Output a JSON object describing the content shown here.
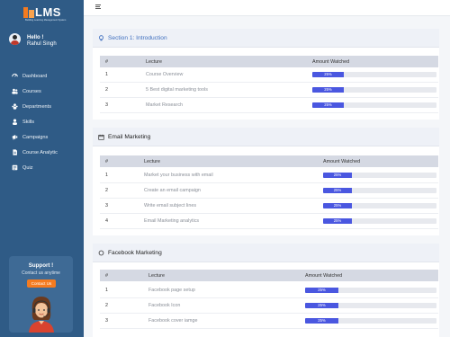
{
  "brand": {
    "name": "LMS",
    "tagline": "Building Learning Management System",
    "accent": "#f47b20",
    "sidebar_bg": "#2f5b86"
  },
  "profile": {
    "greeting": "Hello !",
    "name": "Rahul Singh"
  },
  "nav": [
    {
      "label": "Dashboard",
      "icon": "dashboard-icon"
    },
    {
      "label": "Courses",
      "icon": "users-icon"
    },
    {
      "label": "Departments",
      "icon": "department-icon"
    },
    {
      "label": "Skills",
      "icon": "user-icon"
    },
    {
      "label": "Campaigns",
      "icon": "megaphone-icon"
    },
    {
      "label": "Course Analytic",
      "icon": "document-icon"
    },
    {
      "label": "Quiz",
      "icon": "quiz-icon"
    }
  ],
  "support": {
    "title": "Support !",
    "subtitle": "Contact us anytime",
    "button": "Contact Us"
  },
  "sections": [
    {
      "title": "Section 1: Introduction",
      "icon": "bulb-icon",
      "headers": {
        "num": "#",
        "lecture": "Lecture",
        "watched": "Amount Watched"
      },
      "rows": [
        {
          "num": "1",
          "lecture": "Course Overview",
          "pct": "25%",
          "value": 0.25
        },
        {
          "num": "2",
          "lecture": "5 Best digital marketing tools",
          "pct": "25%",
          "value": 0.25
        },
        {
          "num": "3",
          "lecture": "Market Research",
          "pct": "25%",
          "value": 0.25
        }
      ]
    },
    {
      "title": "Email Marketing",
      "icon": "calendar-icon",
      "headers": {
        "num": "#",
        "lecture": "Lecture",
        "watched": "Amount Watched"
      },
      "rows": [
        {
          "num": "1",
          "lecture": "Market your business with email",
          "pct": "25%",
          "value": 0.25
        },
        {
          "num": "2",
          "lecture": "Create an email campaign",
          "pct": "25%",
          "value": 0.25
        },
        {
          "num": "3",
          "lecture": "Write email subject lines",
          "pct": "25%",
          "value": 0.25
        },
        {
          "num": "4",
          "lecture": "Email Marketing analytics",
          "pct": "25%",
          "value": 0.25
        }
      ]
    },
    {
      "title": "Facebook Marketing",
      "icon": "circle-icon",
      "headers": {
        "num": "#",
        "lecture": "Lecture",
        "watched": "Amount Watched"
      },
      "rows": [
        {
          "num": "1",
          "lecture": "Facebook page setup",
          "pct": "25%",
          "value": 0.25
        },
        {
          "num": "2",
          "lecture": "Facebook Icon",
          "pct": "25%",
          "value": 0.25
        },
        {
          "num": "3",
          "lecture": "Facebook cover iamge",
          "pct": "25%",
          "value": 0.25
        }
      ]
    }
  ]
}
